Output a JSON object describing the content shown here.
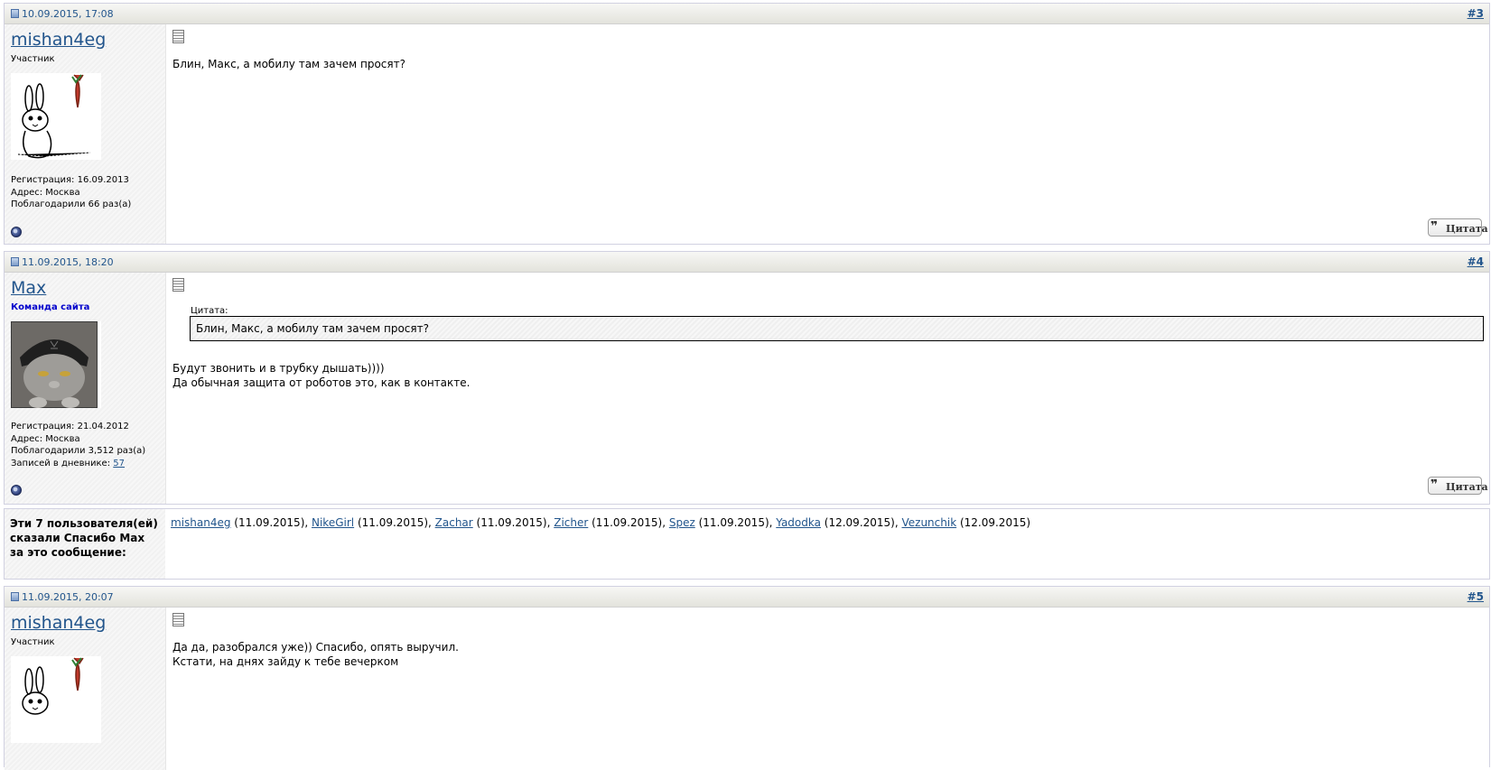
{
  "posts": [
    {
      "date": "10.09.2015, 17:08",
      "number": "#3",
      "username": "mishan4eg",
      "user_title": "Участник",
      "registration": "Регистрация: 16.09.2013",
      "address": "Адрес: Москва",
      "thanked": "Поблагодарили 66 раз(а)",
      "message_lines": [
        "Блин, Макс, а мобилу там зачем просят?"
      ],
      "quote_button": "Цитата"
    },
    {
      "date": "11.09.2015, 18:20",
      "number": "#4",
      "username": "Max",
      "user_title": "Команда сайта",
      "registration": "Регистрация: 21.04.2012",
      "address": "Адрес: Москва",
      "thanked": "Поблагодарили 3,512 раз(а)",
      "diary_label": "Записей в дневнике:",
      "diary_count": "57",
      "quote_label": "Цитата:",
      "quote_text": "Блин, Макс, а мобилу там зачем просят?",
      "message_lines": [
        "Будут звонить и в трубку дышать))))",
        "Да обычная защита от роботов это, как в контакте."
      ],
      "quote_button": "Цитата"
    },
    {
      "date": "11.09.2015, 20:07",
      "number": "#5",
      "username": "mishan4eg",
      "user_title": "Участник",
      "message_lines": [
        "Да да, разобрался уже)) Спасибо, опять выручил.",
        "Кстати, на днях зайду к тебе вечерком"
      ]
    }
  ],
  "thanks": {
    "label": "Эти 7 пользователя(ей) сказали Спасибо Max за это сообщение:",
    "users": [
      {
        "name": "mishan4eg",
        "date": " (11.09.2015), "
      },
      {
        "name": "NikeGirl",
        "date": " (11.09.2015), "
      },
      {
        "name": "Zachar",
        "date": " (11.09.2015), "
      },
      {
        "name": "Zicher",
        "date": " (11.09.2015), "
      },
      {
        "name": "Spez",
        "date": " (11.09.2015), "
      },
      {
        "name": "Yadodka",
        "date": " (12.09.2015), "
      },
      {
        "name": "Vezunchik",
        "date": " (12.09.2015)"
      }
    ]
  },
  "colors": {
    "link": "#22558c",
    "team_title": "#0000cc"
  }
}
